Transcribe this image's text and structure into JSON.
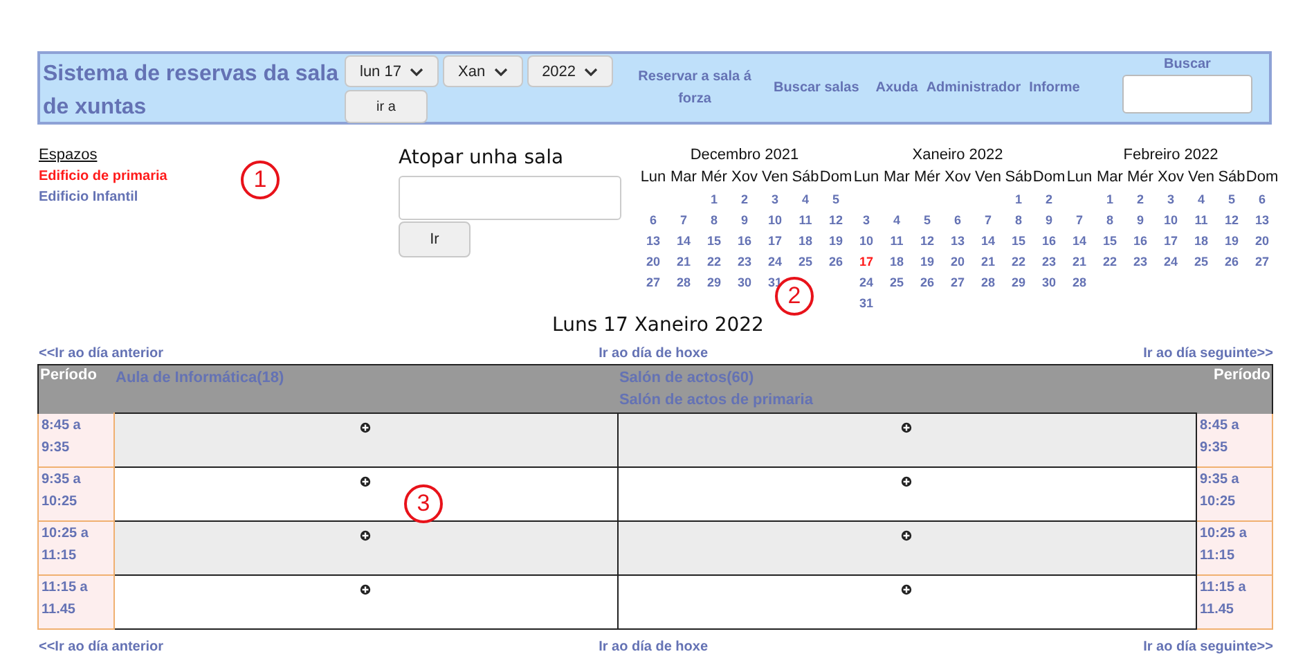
{
  "header": {
    "title": "Sistema de reservas da sala de xuntas",
    "selects": [
      "lun 17",
      "Xan",
      "2022"
    ],
    "goto_button": "ir a",
    "links": [
      "Reservar a sala á forza",
      "Buscar salas",
      "Axuda",
      "Administrador",
      "Informe"
    ],
    "search": {
      "label": "Buscar"
    }
  },
  "spaces": {
    "heading": "Espazos",
    "items": [
      {
        "label": "Edificio de primaria",
        "selected": true
      },
      {
        "label": "Edificio Infantil",
        "selected": false
      }
    ]
  },
  "room_search": {
    "title": "Atopar unha sala",
    "button": "Ir"
  },
  "calendars": [
    {
      "title": "Decembro 2021",
      "weekdays": [
        "Lun",
        "Mar",
        "Mér",
        "Xov",
        "Ven",
        "Sáb",
        "Dom"
      ],
      "weeks": [
        {
          "kind": "lead",
          "days": [
            {
              "n": "1",
              "today": false
            },
            {
              "n": "2",
              "today": false
            },
            {
              "n": "3",
              "today": false
            },
            {
              "n": "4",
              "today": false
            },
            {
              "n": "5",
              "today": false
            }
          ]
        },
        {
          "kind": "full",
          "days": [
            {
              "n": "6",
              "today": false
            },
            {
              "n": "7",
              "today": false
            },
            {
              "n": "8",
              "today": false
            },
            {
              "n": "9",
              "today": false
            },
            {
              "n": "10",
              "today": false
            },
            {
              "n": "11",
              "today": false
            },
            {
              "n": "12",
              "today": false
            }
          ]
        },
        {
          "kind": "full",
          "days": [
            {
              "n": "13",
              "today": false
            },
            {
              "n": "14",
              "today": false
            },
            {
              "n": "15",
              "today": false
            },
            {
              "n": "16",
              "today": false
            },
            {
              "n": "17",
              "today": false
            },
            {
              "n": "18",
              "today": false
            },
            {
              "n": "19",
              "today": false
            }
          ]
        },
        {
          "kind": "full",
          "days": [
            {
              "n": "20",
              "today": false
            },
            {
              "n": "21",
              "today": false
            },
            {
              "n": "22",
              "today": false
            },
            {
              "n": "23",
              "today": false
            },
            {
              "n": "24",
              "today": false
            },
            {
              "n": "25",
              "today": false
            },
            {
              "n": "26",
              "today": false
            }
          ]
        },
        {
          "kind": "trail",
          "days": [
            {
              "n": "27",
              "today": false
            },
            {
              "n": "28",
              "today": false
            },
            {
              "n": "29",
              "today": false
            },
            {
              "n": "30",
              "today": false
            },
            {
              "n": "31",
              "today": false
            }
          ]
        }
      ]
    },
    {
      "title": "Xaneiro 2022",
      "weekdays": [
        "Lun",
        "Mar",
        "Mér",
        "Xov",
        "Ven",
        "Sáb",
        "Dom"
      ],
      "weeks": [
        {
          "kind": "lead",
          "days": [
            {
              "n": "1",
              "today": false
            },
            {
              "n": "2",
              "today": false
            }
          ]
        },
        {
          "kind": "full",
          "days": [
            {
              "n": "3",
              "today": false
            },
            {
              "n": "4",
              "today": false
            },
            {
              "n": "5",
              "today": false
            },
            {
              "n": "6",
              "today": false
            },
            {
              "n": "7",
              "today": false
            },
            {
              "n": "8",
              "today": false
            },
            {
              "n": "9",
              "today": false
            }
          ]
        },
        {
          "kind": "full",
          "days": [
            {
              "n": "10",
              "today": false
            },
            {
              "n": "11",
              "today": false
            },
            {
              "n": "12",
              "today": false
            },
            {
              "n": "13",
              "today": false
            },
            {
              "n": "14",
              "today": false
            },
            {
              "n": "15",
              "today": false
            },
            {
              "n": "16",
              "today": false
            }
          ]
        },
        {
          "kind": "full",
          "days": [
            {
              "n": "17",
              "today": true
            },
            {
              "n": "18",
              "today": false
            },
            {
              "n": "19",
              "today": false
            },
            {
              "n": "20",
              "today": false
            },
            {
              "n": "21",
              "today": false
            },
            {
              "n": "22",
              "today": false
            },
            {
              "n": "23",
              "today": false
            }
          ]
        },
        {
          "kind": "full",
          "days": [
            {
              "n": "24",
              "today": false
            },
            {
              "n": "25",
              "today": false
            },
            {
              "n": "26",
              "today": false
            },
            {
              "n": "27",
              "today": false
            },
            {
              "n": "28",
              "today": false
            },
            {
              "n": "29",
              "today": false
            },
            {
              "n": "30",
              "today": false
            }
          ]
        },
        {
          "kind": "trail",
          "days": [
            {
              "n": "31",
              "today": false
            }
          ]
        }
      ]
    },
    {
      "title": "Febreiro 2022",
      "weekdays": [
        "Lun",
        "Mar",
        "Mér",
        "Xov",
        "Ven",
        "Sáb",
        "Dom"
      ],
      "weeks": [
        {
          "kind": "lead",
          "days": [
            {
              "n": "1",
              "today": false
            },
            {
              "n": "2",
              "today": false
            },
            {
              "n": "3",
              "today": false
            },
            {
              "n": "4",
              "today": false
            },
            {
              "n": "5",
              "today": false
            },
            {
              "n": "6",
              "today": false
            }
          ]
        },
        {
          "kind": "full",
          "days": [
            {
              "n": "7",
              "today": false
            },
            {
              "n": "8",
              "today": false
            },
            {
              "n": "9",
              "today": false
            },
            {
              "n": "10",
              "today": false
            },
            {
              "n": "11",
              "today": false
            },
            {
              "n": "12",
              "today": false
            },
            {
              "n": "13",
              "today": false
            }
          ]
        },
        {
          "kind": "full",
          "days": [
            {
              "n": "14",
              "today": false
            },
            {
              "n": "15",
              "today": false
            },
            {
              "n": "16",
              "today": false
            },
            {
              "n": "17",
              "today": false
            },
            {
              "n": "18",
              "today": false
            },
            {
              "n": "19",
              "today": false
            },
            {
              "n": "20",
              "today": false
            }
          ]
        },
        {
          "kind": "full",
          "days": [
            {
              "n": "21",
              "today": false
            },
            {
              "n": "22",
              "today": false
            },
            {
              "n": "23",
              "today": false
            },
            {
              "n": "24",
              "today": false
            },
            {
              "n": "25",
              "today": false
            },
            {
              "n": "26",
              "today": false
            },
            {
              "n": "27",
              "today": false
            }
          ]
        },
        {
          "kind": "trail",
          "days": [
            {
              "n": "28",
              "today": false
            }
          ]
        }
      ]
    }
  ],
  "day_title": "Luns 17 Xaneiro 2022",
  "nav_top": [
    "<<Ir ao día anterior",
    "Ir ao día de hoxe",
    "Ir ao día seguinte>>"
  ],
  "table": {
    "period_heading_left": "Período",
    "period_heading_right": "Período",
    "rooms": [
      {
        "names": [
          "Aula de Informática(18)"
        ]
      },
      {
        "names": [
          "Salón de actos(60)",
          "Salón de actos de primaria"
        ]
      }
    ],
    "rows": [
      {
        "period": "8:45 a 9:35",
        "period_right": "8:45 a 9:35"
      },
      {
        "period": "9:35 a 10:25",
        "period_right": "9:35 a 10:25"
      },
      {
        "period": "10:25 a 11:15",
        "period_right": "10:25 a 11:15"
      },
      {
        "period": "11:15 a 11.45",
        "period_right": "11:15 a 11.45"
      }
    ]
  },
  "nav_bottom": [
    "<<Ir ao día anterior",
    "Ir ao día de hoxe",
    "Ir ao día seguinte>>"
  ],
  "annotations": [
    {
      "label": "1"
    },
    {
      "label": "2"
    },
    {
      "label": "3"
    }
  ]
}
